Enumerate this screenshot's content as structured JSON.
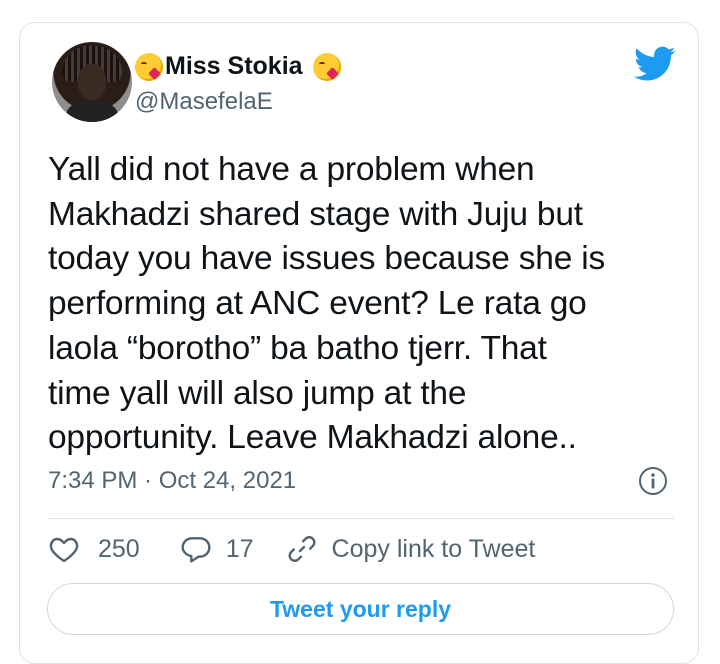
{
  "author": {
    "display_name": "Miss Stokia",
    "handle": "@MasefelaE",
    "emoji_left": "face-blowing-kiss-emoji",
    "emoji_right": "face-blowing-kiss-emoji"
  },
  "tweet": {
    "text": "Yall did not have a problem when\nMakhadzi shared stage with Juju but\ntoday you have issues because she is\nperforming at ANC event? Le rata go\nlaola “borotho” ba batho tjerr. That\ntime yall will also jump at the\nopportunity. Leave Makhadzi alone..",
    "timestamp": "7:34 PM · Oct 24, 2021"
  },
  "actions": {
    "likes": "250",
    "replies": "17",
    "copy_link_label": "Copy link to Tweet"
  },
  "reply_button": {
    "label": "Tweet your reply"
  },
  "colors": {
    "brand_blue": "#1d9bf0",
    "text_primary": "#0f1419",
    "text_secondary": "#536471",
    "border": "#dfe4e8"
  },
  "icons": [
    "twitter-bird-icon",
    "info-icon",
    "heart-icon",
    "reply-icon",
    "link-icon"
  ]
}
